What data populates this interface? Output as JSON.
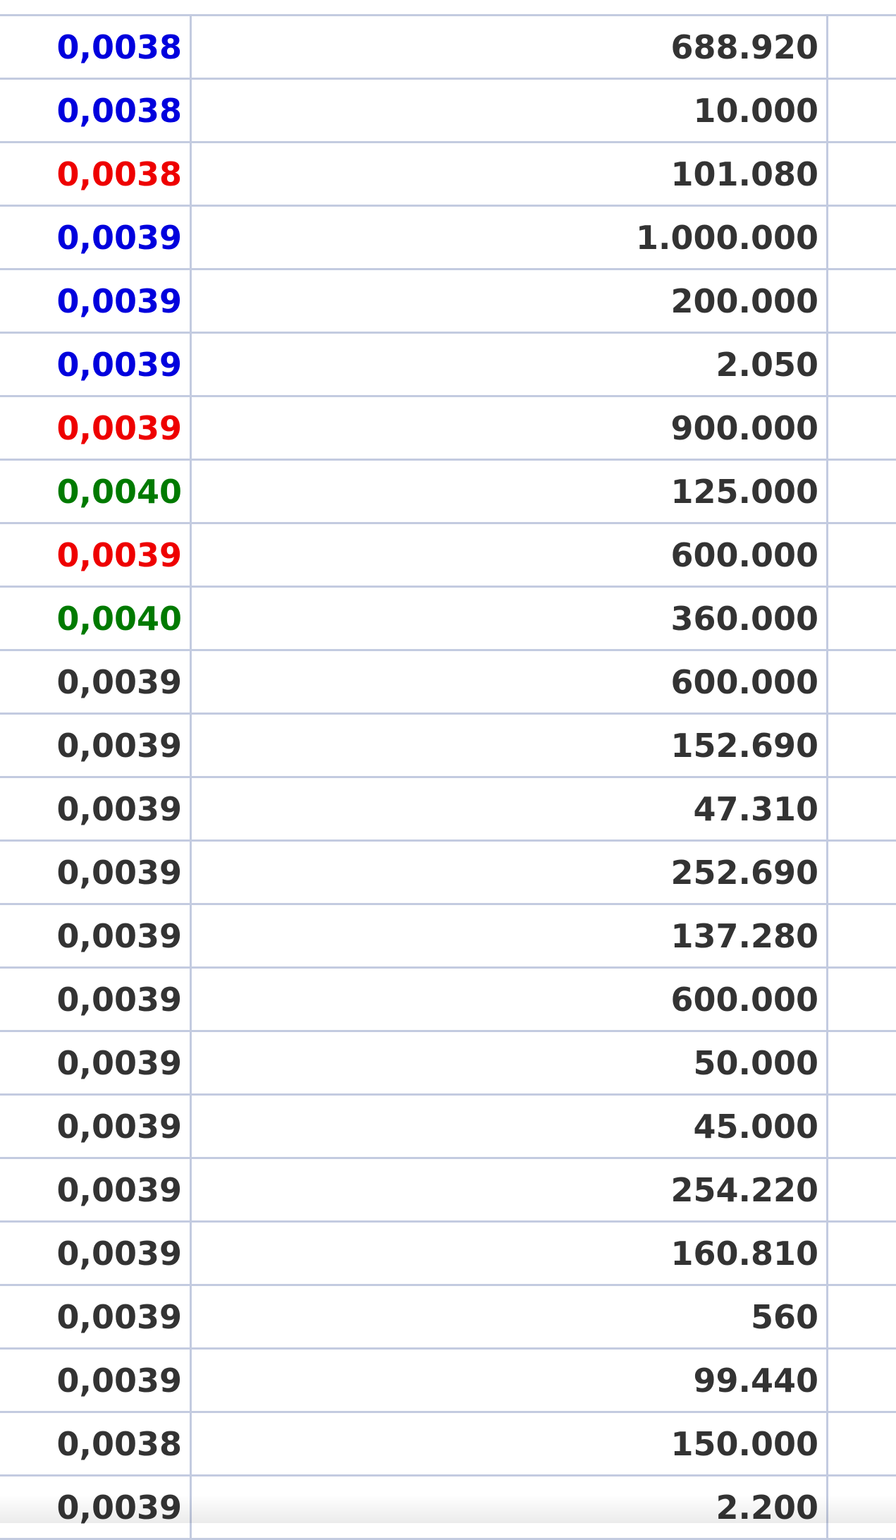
{
  "colors": {
    "buy": "#0000dd",
    "sell": "#ee0000",
    "up": "#007a00",
    "neutral": "#333333",
    "grid": "#c3cbe0"
  },
  "trades": [
    {
      "price": "0,0038",
      "volume": "688.920",
      "side": "buy"
    },
    {
      "price": "0,0038",
      "volume": "10.000",
      "side": "buy"
    },
    {
      "price": "0,0038",
      "volume": "101.080",
      "side": "sell"
    },
    {
      "price": "0,0039",
      "volume": "1.000.000",
      "side": "buy"
    },
    {
      "price": "0,0039",
      "volume": "200.000",
      "side": "buy"
    },
    {
      "price": "0,0039",
      "volume": "2.050",
      "side": "buy"
    },
    {
      "price": "0,0039",
      "volume": "900.000",
      "side": "sell"
    },
    {
      "price": "0,0040",
      "volume": "125.000",
      "side": "up"
    },
    {
      "price": "0,0039",
      "volume": "600.000",
      "side": "sell"
    },
    {
      "price": "0,0040",
      "volume": "360.000",
      "side": "up"
    },
    {
      "price": "0,0039",
      "volume": "600.000",
      "side": "neutral"
    },
    {
      "price": "0,0039",
      "volume": "152.690",
      "side": "neutral"
    },
    {
      "price": "0,0039",
      "volume": "47.310",
      "side": "neutral"
    },
    {
      "price": "0,0039",
      "volume": "252.690",
      "side": "neutral"
    },
    {
      "price": "0,0039",
      "volume": "137.280",
      "side": "neutral"
    },
    {
      "price": "0,0039",
      "volume": "600.000",
      "side": "neutral"
    },
    {
      "price": "0,0039",
      "volume": "50.000",
      "side": "neutral"
    },
    {
      "price": "0,0039",
      "volume": "45.000",
      "side": "neutral"
    },
    {
      "price": "0,0039",
      "volume": "254.220",
      "side": "neutral"
    },
    {
      "price": "0,0039",
      "volume": "160.810",
      "side": "neutral"
    },
    {
      "price": "0,0039",
      "volume": "560",
      "side": "neutral"
    },
    {
      "price": "0,0039",
      "volume": "99.440",
      "side": "neutral"
    },
    {
      "price": "0,0038",
      "volume": "150.000",
      "side": "neutral"
    },
    {
      "price": "0,0039",
      "volume": "2.200",
      "side": "neutral"
    }
  ]
}
